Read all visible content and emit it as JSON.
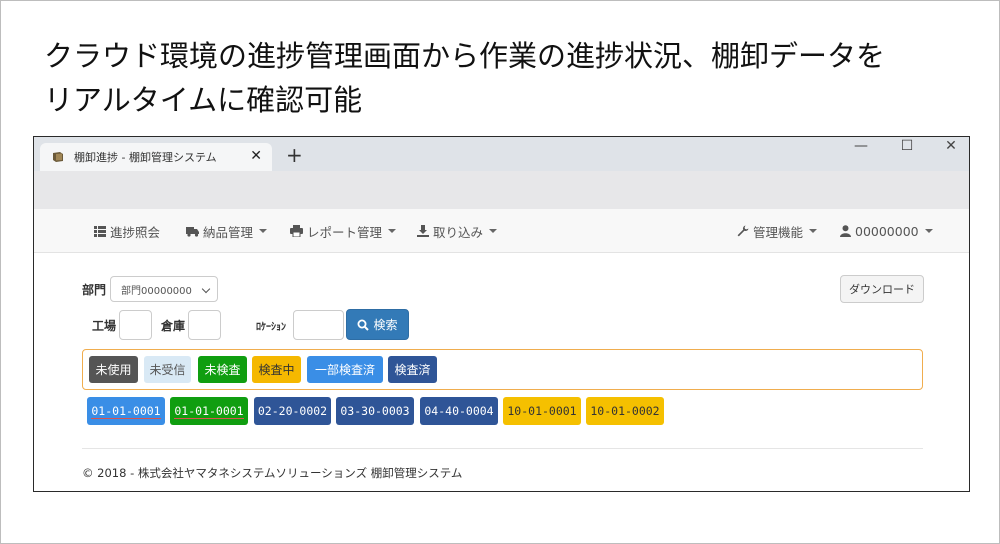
{
  "headline": {
    "line1": "クラウド環境の進捗管理画面から作業の進捗状況、棚卸データを",
    "line2": "リアルタイムに確認可能"
  },
  "browser": {
    "tab_title": "棚卸進捗 - 棚卸管理システム",
    "close_glyph": "✕",
    "new_tab_glyph": "+",
    "minimize_glyph": "—",
    "maximize_glyph": "☐",
    "window_close_glyph": "✕"
  },
  "nav": {
    "progress": "進捗照会",
    "delivery": "納品管理",
    "report": "レポート管理",
    "import": "取り込み",
    "admin": "管理機能",
    "user": "00000000"
  },
  "form": {
    "dept_label": "部門",
    "dept_value": "部門00000000",
    "factory_label": "工場",
    "warehouse_label": "倉庫",
    "location_label": "ﾛｹｰｼｮﾝ",
    "search_label": "検索",
    "download_label": "ダウンロード"
  },
  "legend": [
    {
      "label": "未使用",
      "bg": "#555555",
      "fg": "#ffffff"
    },
    {
      "label": "未受信",
      "bg": "#d9e9f5",
      "fg": "#555555"
    },
    {
      "label": "未検査",
      "bg": "#109e10",
      "fg": "#ffffff"
    },
    {
      "label": "検査中",
      "bg": "#f5b800",
      "fg": "#333333"
    },
    {
      "label": "一部検査済",
      "bg": "#3a8ee6",
      "fg": "#ffffff"
    },
    {
      "label": "検査済",
      "bg": "#2f5597",
      "fg": "#ffffff"
    }
  ],
  "locations": [
    {
      "code": "01-01-0001",
      "bg": "#3a8ee6",
      "fg": "#ffffff",
      "underline": true
    },
    {
      "code": "01-01-0001",
      "bg": "#109e10",
      "fg": "#ffffff",
      "underline": true
    },
    {
      "code": "02-20-0002",
      "bg": "#2f5597",
      "fg": "#ffffff",
      "underline": false
    },
    {
      "code": "03-30-0003",
      "bg": "#2f5597",
      "fg": "#ffffff",
      "underline": false
    },
    {
      "code": "04-40-0004",
      "bg": "#2f5597",
      "fg": "#ffffff",
      "underline": false
    },
    {
      "code": "10-01-0001",
      "bg": "#f5c000",
      "fg": "#333333",
      "underline": false
    },
    {
      "code": "10-01-0002",
      "bg": "#f5c000",
      "fg": "#333333",
      "underline": false
    }
  ],
  "footer": "© 2018 - 株式会社ヤマタネシステムソリューションズ 棚卸管理システム"
}
